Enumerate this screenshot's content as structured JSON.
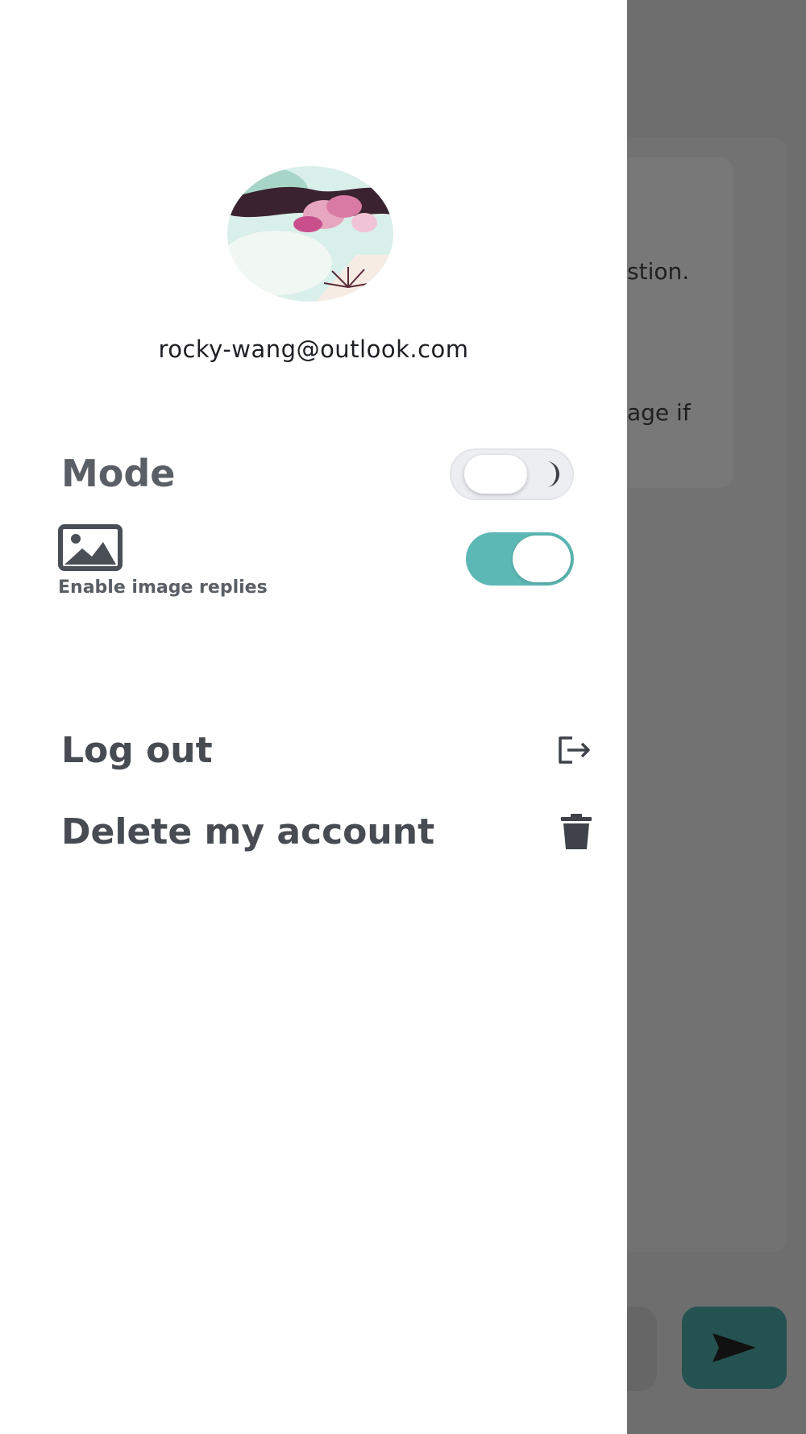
{
  "background": {
    "message_fragment_1": "stion.",
    "message_fragment_2": "age if"
  },
  "drawer": {
    "email": "rocky-wang@outlook.com",
    "mode": {
      "label": "Mode",
      "dark_mode_enabled": false
    },
    "image_replies": {
      "label": "Enable image replies",
      "enabled": true
    },
    "menu": [
      {
        "label": "Log out",
        "icon": "logout-icon"
      },
      {
        "label": "Delete my account",
        "icon": "trash-icon"
      }
    ]
  },
  "colors": {
    "toggle_on": "#5cb8b4",
    "send_button": "#245251",
    "text_primary": "#474b52",
    "overlay": "#6f6f6f"
  }
}
